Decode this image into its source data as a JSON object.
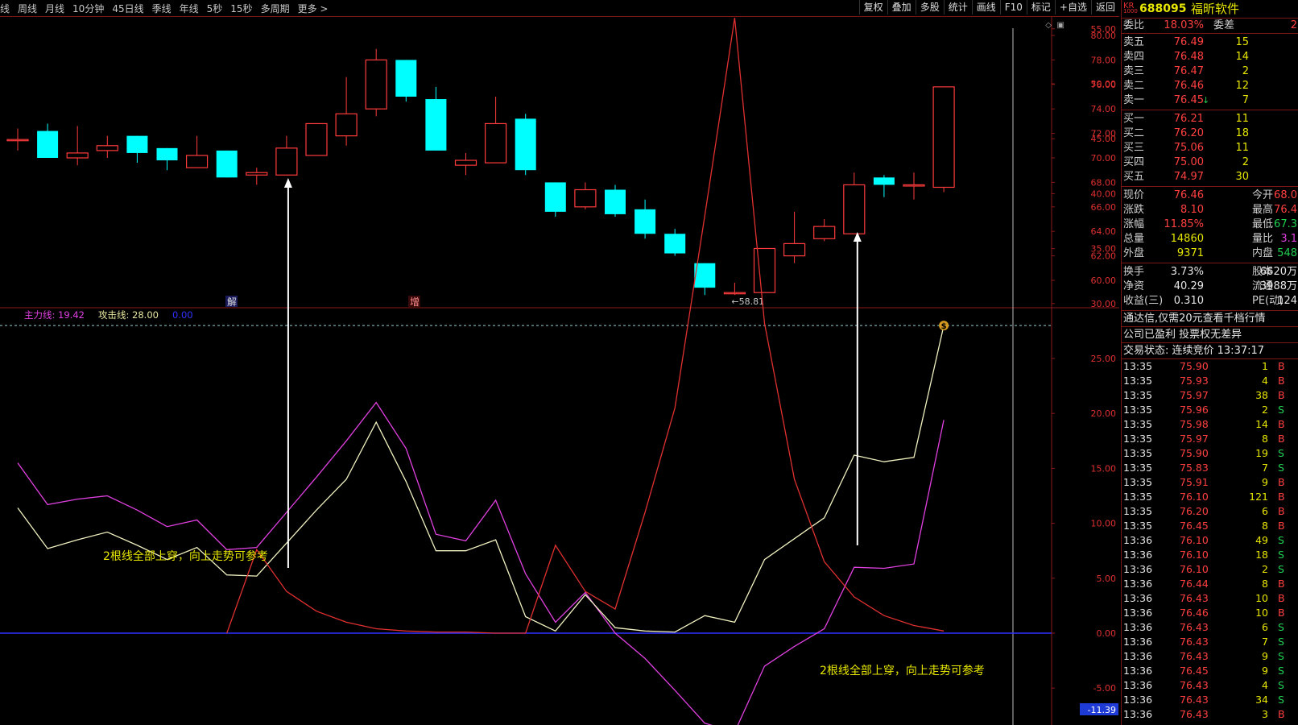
{
  "toolbar": {
    "periods": [
      "线",
      "周线",
      "月线",
      "10分钟",
      "45日线",
      "季线",
      "年线",
      "5秒",
      "15秒",
      "多周期",
      "更多 >"
    ],
    "tools": [
      "复权",
      "叠加",
      "多股",
      "统计",
      "画线",
      "F10",
      "标记",
      "+自选",
      "返回"
    ]
  },
  "colors": {
    "up": "#ff3b3b",
    "down": "#00ffff",
    "main_line": "#e040e0",
    "attack_line": "#f0f0c0",
    "third_line": "#e03030",
    "zero_line": "#3030ff"
  },
  "chart_data": [
    {
      "type": "candlestick",
      "ylim": [
        58.81,
        80.0
      ],
      "yticks": [
        "80.00",
        "78.00",
        "76.00",
        "74.00",
        "72.00",
        "70.00",
        "68.00",
        "66.00",
        "64.00",
        "62.00",
        "60.00"
      ],
      "low_marker": "58.81",
      "labels": {
        "jie": "解",
        "zeng": "增"
      },
      "candles": [
        {
          "o": 71.5,
          "c": 71.5,
          "h": 72.4,
          "l": 70.6
        },
        {
          "o": 72.2,
          "c": 70.0,
          "h": 72.8,
          "l": 70.0
        },
        {
          "o": 70.0,
          "c": 70.4,
          "h": 72.6,
          "l": 69.4
        },
        {
          "o": 70.6,
          "c": 71.0,
          "h": 71.8,
          "l": 70.0
        },
        {
          "o": 71.8,
          "c": 70.4,
          "h": 71.8,
          "l": 69.6
        },
        {
          "o": 70.8,
          "c": 69.8,
          "h": 70.8,
          "l": 69.0
        },
        {
          "o": 69.2,
          "c": 70.2,
          "h": 71.8,
          "l": 69.2
        },
        {
          "o": 70.6,
          "c": 68.4,
          "h": 70.6,
          "l": 68.4
        },
        {
          "o": 68.6,
          "c": 68.8,
          "h": 69.2,
          "l": 67.8
        },
        {
          "o": 68.6,
          "c": 70.8,
          "h": 71.8,
          "l": 68.6
        },
        {
          "o": 70.2,
          "c": 72.8,
          "h": 72.8,
          "l": 70.2
        },
        {
          "o": 71.8,
          "c": 73.6,
          "h": 76.6,
          "l": 71.0
        },
        {
          "o": 74.0,
          "c": 78.0,
          "h": 78.9,
          "l": 73.4
        },
        {
          "o": 78.0,
          "c": 75.0,
          "h": 78.0,
          "l": 74.6
        },
        {
          "o": 74.8,
          "c": 70.6,
          "h": 75.8,
          "l": 70.6
        },
        {
          "o": 69.4,
          "c": 69.8,
          "h": 70.4,
          "l": 68.6
        },
        {
          "o": 69.6,
          "c": 72.8,
          "h": 75.0,
          "l": 69.6
        },
        {
          "o": 73.2,
          "c": 69.0,
          "h": 73.6,
          "l": 68.6
        },
        {
          "o": 68.0,
          "c": 65.6,
          "h": 68.0,
          "l": 65.2
        },
        {
          "o": 66.0,
          "c": 67.4,
          "h": 68.0,
          "l": 65.8
        },
        {
          "o": 67.4,
          "c": 65.4,
          "h": 67.8,
          "l": 65.2
        },
        {
          "o": 65.8,
          "c": 63.8,
          "h": 66.6,
          "l": 63.4
        },
        {
          "o": 63.8,
          "c": 62.2,
          "h": 64.2,
          "l": 62.0
        },
        {
          "o": 61.4,
          "c": 59.4,
          "h": 61.4,
          "l": 58.8
        },
        {
          "o": 59.0,
          "c": 59.0,
          "h": 59.8,
          "l": 58.81
        },
        {
          "o": 59.0,
          "c": 62.6,
          "h": 62.6,
          "l": 59.0
        },
        {
          "o": 62.0,
          "c": 63.0,
          "h": 65.6,
          "l": 61.4
        },
        {
          "o": 63.4,
          "c": 64.4,
          "h": 65.0,
          "l": 63.2
        },
        {
          "o": 63.8,
          "c": 67.8,
          "h": 68.8,
          "l": 63.8
        },
        {
          "o": 68.4,
          "c": 67.8,
          "h": 68.6,
          "l": 66.8
        },
        {
          "o": 67.8,
          "c": 67.8,
          "h": 68.8,
          "l": 66.6
        },
        {
          "o": 67.6,
          "c": 75.8,
          "h": 75.8,
          "l": 67.2
        }
      ]
    },
    {
      "type": "line",
      "ylim": [
        -11.39,
        57.0
      ],
      "yticks": [
        "55.00",
        "50.00",
        "45.00",
        "40.00",
        "35.00",
        "30.00",
        "25.00",
        "20.00",
        "15.00",
        "10.00",
        "5.00",
        "0.00",
        "-5.00"
      ],
      "current_value": "-11.39",
      "legend": [
        {
          "name": "主力线:",
          "value": "19.42"
        },
        {
          "name": "攻击线:",
          "value": "28.00"
        },
        {
          "name": "",
          "value": "0.00"
        }
      ],
      "ref_line": 28.0,
      "series": [
        {
          "values": [
            15.5,
            11.7,
            12.2,
            12.5,
            11.2,
            9.7,
            10.3,
            7.6,
            7.8,
            11.0,
            14.2,
            17.5,
            21.0,
            16.8,
            9.0,
            8.4,
            12.1,
            5.4,
            1.0,
            3.7,
            0.0,
            -2.3,
            -5.2,
            -8.2,
            -9.0,
            -3.0,
            -1.2,
            0.4,
            6.0,
            5.9,
            6.3,
            19.4
          ]
        },
        {
          "values": [
            11.4,
            7.7,
            8.5,
            9.2,
            8.0,
            6.7,
            7.8,
            5.3,
            5.2,
            8.2,
            11.2,
            14.0,
            19.2,
            13.8,
            7.5,
            7.5,
            8.5,
            1.5,
            0.2,
            3.5,
            0.5,
            0.2,
            0.1,
            1.6,
            1.0,
            6.7,
            8.6,
            10.5,
            16.2,
            15.6,
            16.0,
            28.0
          ]
        },
        {
          "values": [
            null,
            null,
            null,
            null,
            null,
            null,
            null,
            0.0,
            7.6,
            3.8,
            2.0,
            1.0,
            0.4,
            0.2,
            0.1,
            0.1,
            0.0,
            0.0,
            8.0,
            3.8,
            2.2,
            11.0,
            20.5,
            38.0,
            56.0,
            28.2,
            14.0,
            6.5,
            3.3,
            1.6,
            0.7,
            0.2
          ]
        }
      ]
    }
  ],
  "annotations": {
    "left_text": "2根线全部上穿，向上走势可参考",
    "right_text": "2根线全部上穿，向上走势可参考",
    "arrow_candles": [
      9,
      28
    ],
    "dollar_icon": "$"
  },
  "quote": {
    "market": "KR",
    "market_sub": "1000",
    "code": "688095",
    "name": "福昕软件",
    "weibi_label": "委比",
    "weibi_value": "18.03%",
    "weicha_label": "委差",
    "weicha_value": "2",
    "sell": [
      {
        "label": "卖五",
        "price": "76.49",
        "vol": "15"
      },
      {
        "label": "卖四",
        "price": "76.48",
        "vol": "14"
      },
      {
        "label": "卖三",
        "price": "76.47",
        "vol": "2"
      },
      {
        "label": "卖二",
        "price": "76.46",
        "vol": "12"
      },
      {
        "label": "卖一",
        "price": "76.45",
        "vol": "7"
      }
    ],
    "buy": [
      {
        "label": "买一",
        "price": "76.21",
        "vol": "11"
      },
      {
        "label": "买二",
        "price": "76.20",
        "vol": "18"
      },
      {
        "label": "买三",
        "price": "75.06",
        "vol": "11"
      },
      {
        "label": "买四",
        "price": "75.00",
        "vol": "2"
      },
      {
        "label": "买五",
        "price": "74.97",
        "vol": "30"
      }
    ],
    "stats1": [
      {
        "l1": "现价",
        "v1": "76.46",
        "l2": "今开",
        "v2": "68.0"
      },
      {
        "l1": "涨跌",
        "v1": "8.10",
        "l2": "最高",
        "v2": "76.4"
      },
      {
        "l1": "涨幅",
        "v1": "11.85%",
        "l2": "最低",
        "v2": "67.3"
      },
      {
        "l1": "总量",
        "v1": "14860",
        "l2": "量比",
        "v2": "3.1"
      },
      {
        "l1": "外盘",
        "v1": "9371",
        "l2": "内盘",
        "v2": "548"
      }
    ],
    "stats2": [
      {
        "l1": "换手",
        "v1": "3.73%",
        "l2": "股本",
        "v2": "6620万"
      },
      {
        "l1": "净资",
        "v1": "40.29",
        "l2": "流通",
        "v2": "3988万"
      },
      {
        "l1": "收益(三)",
        "v1": "0.310",
        "l2": "PE(动)",
        "v2": "124"
      }
    ],
    "notes": [
      "通达信,仅需20元查看千档行情",
      "公司已盈利 投票权无差异"
    ],
    "trade_status": "交易状态: 连续竞价 13:37:17"
  },
  "ticks": [
    {
      "t": "13:35",
      "p": "75.90",
      "v": "1",
      "s": "B"
    },
    {
      "t": "13:35",
      "p": "75.93",
      "v": "4",
      "s": "B"
    },
    {
      "t": "13:35",
      "p": "75.97",
      "v": "38",
      "s": "B"
    },
    {
      "t": "13:35",
      "p": "75.96",
      "v": "2",
      "s": "S"
    },
    {
      "t": "13:35",
      "p": "75.98",
      "v": "14",
      "s": "B"
    },
    {
      "t": "13:35",
      "p": "75.97",
      "v": "8",
      "s": "B"
    },
    {
      "t": "13:35",
      "p": "75.90",
      "v": "19",
      "s": "S"
    },
    {
      "t": "13:35",
      "p": "75.83",
      "v": "7",
      "s": "S"
    },
    {
      "t": "13:35",
      "p": "75.91",
      "v": "9",
      "s": "B"
    },
    {
      "t": "13:35",
      "p": "76.10",
      "v": "121",
      "s": "B"
    },
    {
      "t": "13:35",
      "p": "76.20",
      "v": "6",
      "s": "B"
    },
    {
      "t": "13:35",
      "p": "76.45",
      "v": "8",
      "s": "B"
    },
    {
      "t": "13:36",
      "p": "76.10",
      "v": "49",
      "s": "S"
    },
    {
      "t": "13:36",
      "p": "76.10",
      "v": "18",
      "s": "S"
    },
    {
      "t": "13:36",
      "p": "76.10",
      "v": "2",
      "s": "S"
    },
    {
      "t": "13:36",
      "p": "76.44",
      "v": "8",
      "s": "B"
    },
    {
      "t": "13:36",
      "p": "76.43",
      "v": "10",
      "s": "B"
    },
    {
      "t": "13:36",
      "p": "76.46",
      "v": "10",
      "s": "B"
    },
    {
      "t": "13:36",
      "p": "76.43",
      "v": "6",
      "s": "S"
    },
    {
      "t": "13:36",
      "p": "76.43",
      "v": "7",
      "s": "S"
    },
    {
      "t": "13:36",
      "p": "76.43",
      "v": "9",
      "s": "S"
    },
    {
      "t": "13:36",
      "p": "76.45",
      "v": "9",
      "s": "S"
    },
    {
      "t": "13:36",
      "p": "76.43",
      "v": "4",
      "s": "S"
    },
    {
      "t": "13:36",
      "p": "76.43",
      "v": "34",
      "s": "S"
    },
    {
      "t": "13:36",
      "p": "76.43",
      "v": "3",
      "s": "B"
    }
  ]
}
